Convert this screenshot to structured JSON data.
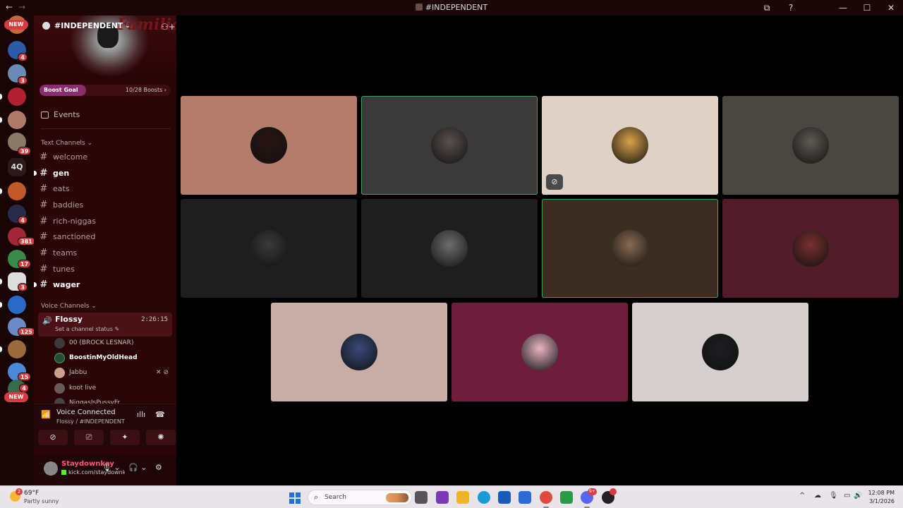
{
  "window": {
    "title": "#INDEPENDENT",
    "back": "←",
    "forward": "→",
    "controls": [
      "—",
      "☐",
      "✕"
    ],
    "extras": [
      "⧉",
      "?"
    ]
  },
  "rail": {
    "new_top": "NEW",
    "new_bottom": "NEW",
    "text_server": "4Q",
    "badges": [
      "4",
      "3",
      "39",
      "4",
      "381",
      "17",
      "3",
      "125",
      "15",
      "4"
    ]
  },
  "server": {
    "name": "#INDEPENDENT",
    "caret": "⌄",
    "banner_text": "Familia",
    "boost_label": "Boost Goal",
    "boost_count": "10/28 Boosts ›",
    "events_label": "Events"
  },
  "text_category": "Text Channels ⌄",
  "text_channels": [
    {
      "name": "welcome"
    },
    {
      "name": "gen"
    },
    {
      "name": "eats"
    },
    {
      "name": "baddies"
    },
    {
      "name": "rich-niggas"
    },
    {
      "name": "sanctioned"
    },
    {
      "name": "teams"
    },
    {
      "name": "tunes"
    },
    {
      "name": "wager"
    }
  ],
  "voice_category": "Voice Channels ⌄",
  "voice_channel": {
    "name": "Flossy",
    "time": "2:26:15",
    "status": "Set a channel status ✎"
  },
  "voice_users": [
    {
      "name": "00 (BROCK LESNAR)",
      "color": "#3a3a3a"
    },
    {
      "name": "BoostinMyOldHead",
      "color": "#2a4a3a"
    },
    {
      "name": "Jabbu",
      "color": "#c9a08a",
      "muted": "✕ ⊘"
    },
    {
      "name": "koot live",
      "color": "#6a5a5a"
    },
    {
      "name": "NiggasIsPussyFr",
      "color": "#444"
    }
  ],
  "voice_panel": {
    "title": "Voice Connected",
    "subtitle": "Flossy / #INDEPENDENT",
    "signal": "📶",
    "wave": "ıllı",
    "hangup": "☎",
    "buttons": [
      "⊘",
      "⎚",
      "✦",
      "✺"
    ]
  },
  "user": {
    "name": "Staydownkay",
    "status": "kick.com/staydownkay",
    "mic": "🎙 ⌄",
    "headset": "🎧 ⌄",
    "settings": "⚙"
  },
  "tiles": [
    {
      "bg": "#b47d6b",
      "av": "#2a1512"
    },
    {
      "bg": "#3b3a3b",
      "av": "#5a5050",
      "speaking": true
    },
    {
      "bg": "#dfd1c6",
      "av": "#d9a24a",
      "badge": "⊘"
    },
    {
      "bg": "#4a4742",
      "av": "#5f5b55"
    },
    {
      "bg": "#1e1e1e",
      "av": "#3a3a3a"
    },
    {
      "bg": "#1e1e1e",
      "av": "#6e6e6e"
    },
    {
      "bg": "#3b2d22",
      "av": "#8a6a52",
      "speaking": true
    },
    {
      "bg": "#521c2a",
      "av": "#7a3030"
    },
    {
      "bg": "#c7ada6",
      "av": "#3a4a7a"
    },
    {
      "bg": "#6e1e3c",
      "av": "#e9b5c4"
    },
    {
      "bg": "#d5cfcf",
      "av": "#1e1e22"
    }
  ],
  "taskbar": {
    "temp": "69°F",
    "condition": "Partly sunny",
    "weather_badge": "2",
    "search_placeholder": "Search",
    "time": "12:08 PM",
    "date": "3/1/2026",
    "discord_badge": "9+",
    "tray": [
      "^",
      "☁",
      "🎙",
      "▭",
      "🔊"
    ]
  }
}
